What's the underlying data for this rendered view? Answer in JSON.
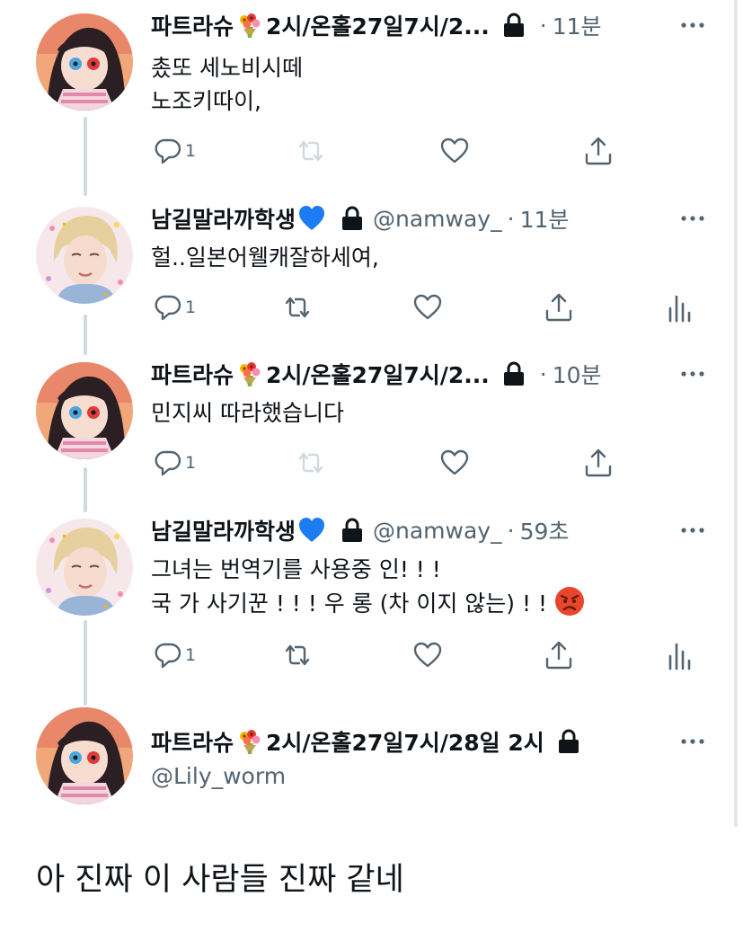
{
  "tweets": [
    {
      "name_a": "파트라슈",
      "name_b": "2시/온홀27일7시/2...",
      "handle": "",
      "sep": "·",
      "time": "11분",
      "lines": [
        "촜또 세노비시떼",
        "노조키따이,"
      ],
      "reply_count": "1",
      "has_analytics": false,
      "retweet_enabled": false
    },
    {
      "name_a": "남길말라까학생",
      "name_b": "",
      "handle": "@namway_",
      "sep": "·",
      "time": "11분",
      "lines": [
        "헐..일본어웰캐잘하세여,"
      ],
      "reply_count": "1",
      "has_analytics": true,
      "retweet_enabled": true
    },
    {
      "name_a": "파트라슈",
      "name_b": "2시/온홀27일7시/2...",
      "handle": "",
      "sep": "·",
      "time": "10분",
      "lines": [
        "민지씨 따라했습니다"
      ],
      "reply_count": "1",
      "has_analytics": false,
      "retweet_enabled": false
    },
    {
      "name_a": "남길말라까학생",
      "name_b": "",
      "handle": "@namway_",
      "sep": "·",
      "time": "59초",
      "lines": [
        "그녀는 번역기를 사용중 인! ! !",
        "국 가 사기꾼 ! ! ! 우 롱 (차 이지 않는) ! !"
      ],
      "reply_count": "1",
      "has_analytics": true,
      "retweet_enabled": true
    },
    {
      "name_a": "파트라슈",
      "name_b": "2시/온홀27일7시/28일 2시",
      "handle": "@Lily_worm",
      "sep": "",
      "time": "",
      "lines": [],
      "reply_count": "",
      "has_analytics": false,
      "retweet_enabled": false
    }
  ],
  "comment": "아 진짜 이 사람들 진짜 같네",
  "icons": [
    "bouquet-emoji",
    "blue-heart-emoji",
    "lock-icon",
    "more-icon",
    "reply-icon",
    "retweet-icon",
    "like-icon",
    "share-icon",
    "analytics-icon",
    "angry-face-emoji"
  ],
  "colors": {
    "text": "#0f1419",
    "secondary": "#536471",
    "disabled": "#cfd9de",
    "thread_line": "#cfd9de",
    "blue_heart": "#1d7cf2"
  }
}
